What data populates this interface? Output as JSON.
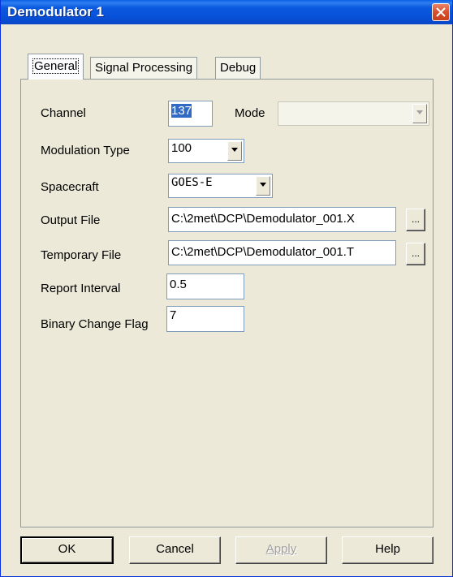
{
  "window": {
    "title": "Demodulator 1"
  },
  "tabs": [
    {
      "label": "General",
      "active": true
    },
    {
      "label": "Signal Processing",
      "active": false
    },
    {
      "label": "Debug",
      "active": false
    }
  ],
  "form": {
    "channel": {
      "label": "Channel",
      "value": "137"
    },
    "mode": {
      "label": "Mode",
      "value": ""
    },
    "modulation_type": {
      "label": "Modulation Type",
      "value": "100"
    },
    "spacecraft": {
      "label": "Spacecraft",
      "value": "GOES-E"
    },
    "output_file": {
      "label": "Output File",
      "value": "C:\\2met\\DCP\\Demodulator_001.X",
      "browse_label": "..."
    },
    "temporary_file": {
      "label": "Temporary File",
      "value": "C:\\2met\\DCP\\Demodulator_001.T",
      "browse_label": "..."
    },
    "report_interval": {
      "label": "Report Interval",
      "value": "0.5"
    },
    "binary_change_flag": {
      "label": "Binary Change Flag",
      "value": "7"
    }
  },
  "buttons": {
    "ok": "OK",
    "cancel": "Cancel",
    "apply": "Apply",
    "help": "Help"
  },
  "colors": {
    "titlebar": "#0751D8",
    "selection": "#316AC5",
    "face": "#ECE9D8",
    "close": "#D6502C"
  }
}
